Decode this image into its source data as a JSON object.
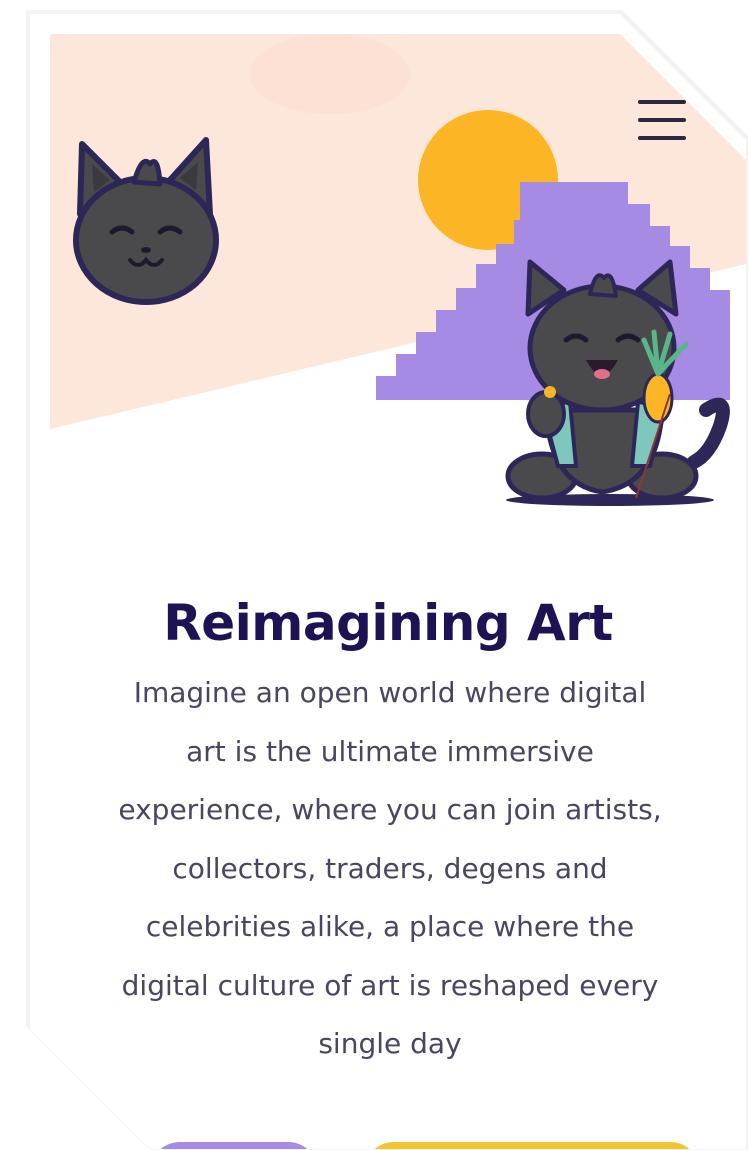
{
  "hero": {
    "headline": "Reimagining Art",
    "description": "Imagine an open world where digital art is the ultimate immersive experience, where you can join artists, collectors, traders, degens and celebrities alike, a place where the digital culture of art is reshaped every single day"
  },
  "colors": {
    "background_peach": "#fde6da",
    "sun": "#fcb625",
    "pyramid": "#a58be3",
    "cat_body": "#4a4a4d",
    "cat_outline": "#2d2758",
    "headline": "#1f1254",
    "body_text": "#4a4660",
    "button_primary": "#a58be3",
    "button_secondary": "#f1c530"
  },
  "icons": {
    "menu": "hamburger-menu-icon"
  }
}
